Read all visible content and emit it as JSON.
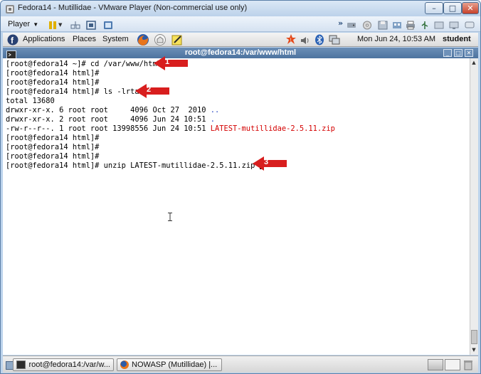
{
  "vm_window": {
    "title": "Fedora14 - Mutillidae - VMware Player (Non-commercial use only)",
    "player_menu_label": "Player",
    "controls": {
      "minimize": "–",
      "maximize": "□",
      "close": "✕"
    }
  },
  "gnome_panel": {
    "menus": [
      "Applications",
      "Places",
      "System"
    ],
    "clock": "Mon Jun 24, 10:53 AM",
    "user": "student"
  },
  "terminal": {
    "title": "root@fedora14:/var/www/html",
    "lines": [
      {
        "prompt": "[root@fedora14 ~]# ",
        "command": "cd /var/www/html"
      },
      {
        "prompt": "[root@fedora14 html]#",
        "command": ""
      },
      {
        "prompt": "[root@fedora14 html]#",
        "command": ""
      },
      {
        "prompt": "[root@fedora14 html]# ",
        "command": "ls -lrta"
      },
      {
        "text": "total 13680"
      },
      {
        "text": "drwxr-xr-x. 6 root root     4096 Oct 27  2010 ",
        "name": ".."
      },
      {
        "text": "drwxr-xr-x. 2 root root     4096 Jun 24 10:51 ",
        "name": "."
      },
      {
        "text": "-rw-r--r--. 1 root root 13998556 Jun 24 10:51 ",
        "name": "LATEST-mutillidae-2.5.11.zip"
      },
      {
        "prompt": "[root@fedora14 html]#",
        "command": ""
      },
      {
        "prompt": "[root@fedora14 html]#",
        "command": ""
      },
      {
        "prompt": "[root@fedora14 html]#",
        "command": ""
      },
      {
        "prompt": "[root@fedora14 html]# ",
        "command": "unzip LATEST-mutillidae-2.5.11.zip "
      }
    ]
  },
  "annotations": [
    "1",
    "2",
    "3"
  ],
  "taskbar": {
    "items": [
      "root@fedora14:/var/w...",
      "NOWASP (Mutillidae) |..."
    ]
  },
  "colors": {
    "arrow": "#d81e1e",
    "zip_file": "#d40000",
    "dir_entry": "#1d3fbf"
  }
}
